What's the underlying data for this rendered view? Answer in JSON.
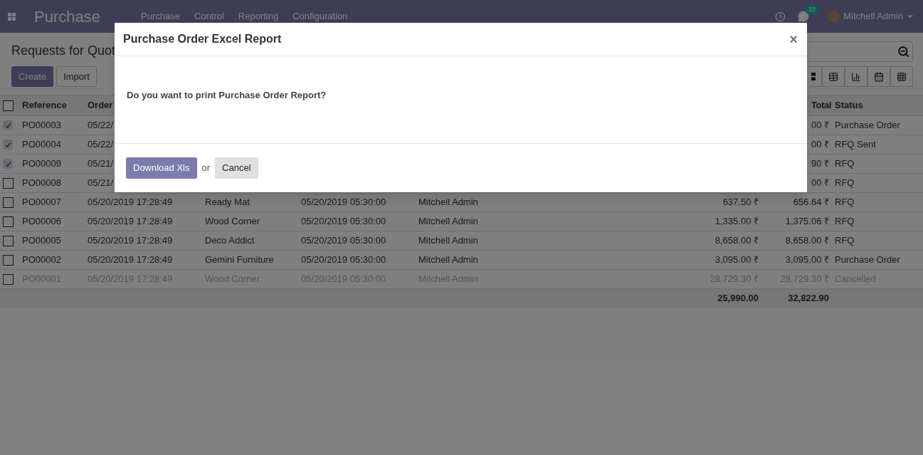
{
  "navbar": {
    "app_title": "Purchase",
    "menu": [
      "Purchase",
      "Control",
      "Reporting",
      "Configuration"
    ],
    "message_count": "22",
    "user_name": "Mitchell Admin"
  },
  "page": {
    "title": "Requests for Quot",
    "buttons": [
      "Create",
      "Import"
    ]
  },
  "table": {
    "header": {
      "checked": false,
      "column_1": "Reference",
      "column_2": "Order",
      "column_7": "Total",
      "column_8": "Status"
    },
    "rows": [
      {
        "selected": true,
        "muted": false,
        "column_1": "PO00003",
        "column_2": "05/22/",
        "column_7": "00 ₹",
        "column_8": "Purchase Order"
      },
      {
        "selected": true,
        "muted": false,
        "column_1": "PO00004",
        "column_2": "05/22/",
        "column_7": "00 ₹",
        "column_8": "RFQ Sent"
      },
      {
        "selected": true,
        "muted": false,
        "column_1": "PO00009",
        "column_2": "05/21/",
        "column_7": "90 ₹",
        "column_8": "RFQ"
      },
      {
        "selected": false,
        "muted": false,
        "column_1": "PO00008",
        "column_2": "05/21/",
        "column_7": "00 ₹",
        "column_8": "RFQ"
      },
      {
        "selected": false,
        "muted": false,
        "column_1": "PO00007",
        "column_2": "05/20/2019 17:28:49",
        "column_3": "Ready Mat",
        "column_4": "05/20/2019 05:30:00",
        "column_5": "Mitchell Admin",
        "column_6": "637.50 ₹",
        "column_7": "656.64 ₹",
        "column_8": "RFQ"
      },
      {
        "selected": false,
        "muted": false,
        "column_1": "PO00006",
        "column_2": "05/20/2019 17:28:49",
        "column_3": "Wood Corner",
        "column_4": "05/20/2019 05:30:00",
        "column_5": "Mitchell Admin",
        "column_6": "1,335.00 ₹",
        "column_7": "1,375.06 ₹",
        "column_8": "RFQ"
      },
      {
        "selected": false,
        "muted": false,
        "column_1": "PO00005",
        "column_2": "05/20/2019 17:28:49",
        "column_3": "Deco Addict",
        "column_4": "05/20/2019 05:30:00",
        "column_5": "Mitchell Admin",
        "column_6": "8,658.00 ₹",
        "column_7": "8,658.00 ₹",
        "column_8": "RFQ"
      },
      {
        "selected": false,
        "muted": false,
        "column_1": "PO00002",
        "column_2": "05/20/2019 17:28:49",
        "column_3": "Gemini Furniture",
        "column_4": "05/20/2019 05:30:00",
        "column_5": "Mitchell Admin",
        "column_6": "3,095.00 ₹",
        "column_7": "3,095.00 ₹",
        "column_8": "Purchase Order"
      },
      {
        "selected": false,
        "muted": true,
        "column_1": "PO00001",
        "column_2": "05/20/2019 17:28:49",
        "column_3": "Wood Corner",
        "column_4": "05/20/2019 05:30:00",
        "column_5": "Mitchell Admin",
        "column_6": "28,729.30 ₹",
        "column_7": "28,729.30 ₹",
        "column_8": "Cancelled"
      }
    ],
    "totals": {
      "column_6": "25,990.00",
      "column_7": "32,822.90"
    }
  },
  "dialog": {
    "title": "Purchase Order Excel Report",
    "close": "×",
    "message": "Do you want to print Purchase Order Report?",
    "primary_button": "Download Xls",
    "separator": "or",
    "secondary_button": "Cancel"
  }
}
